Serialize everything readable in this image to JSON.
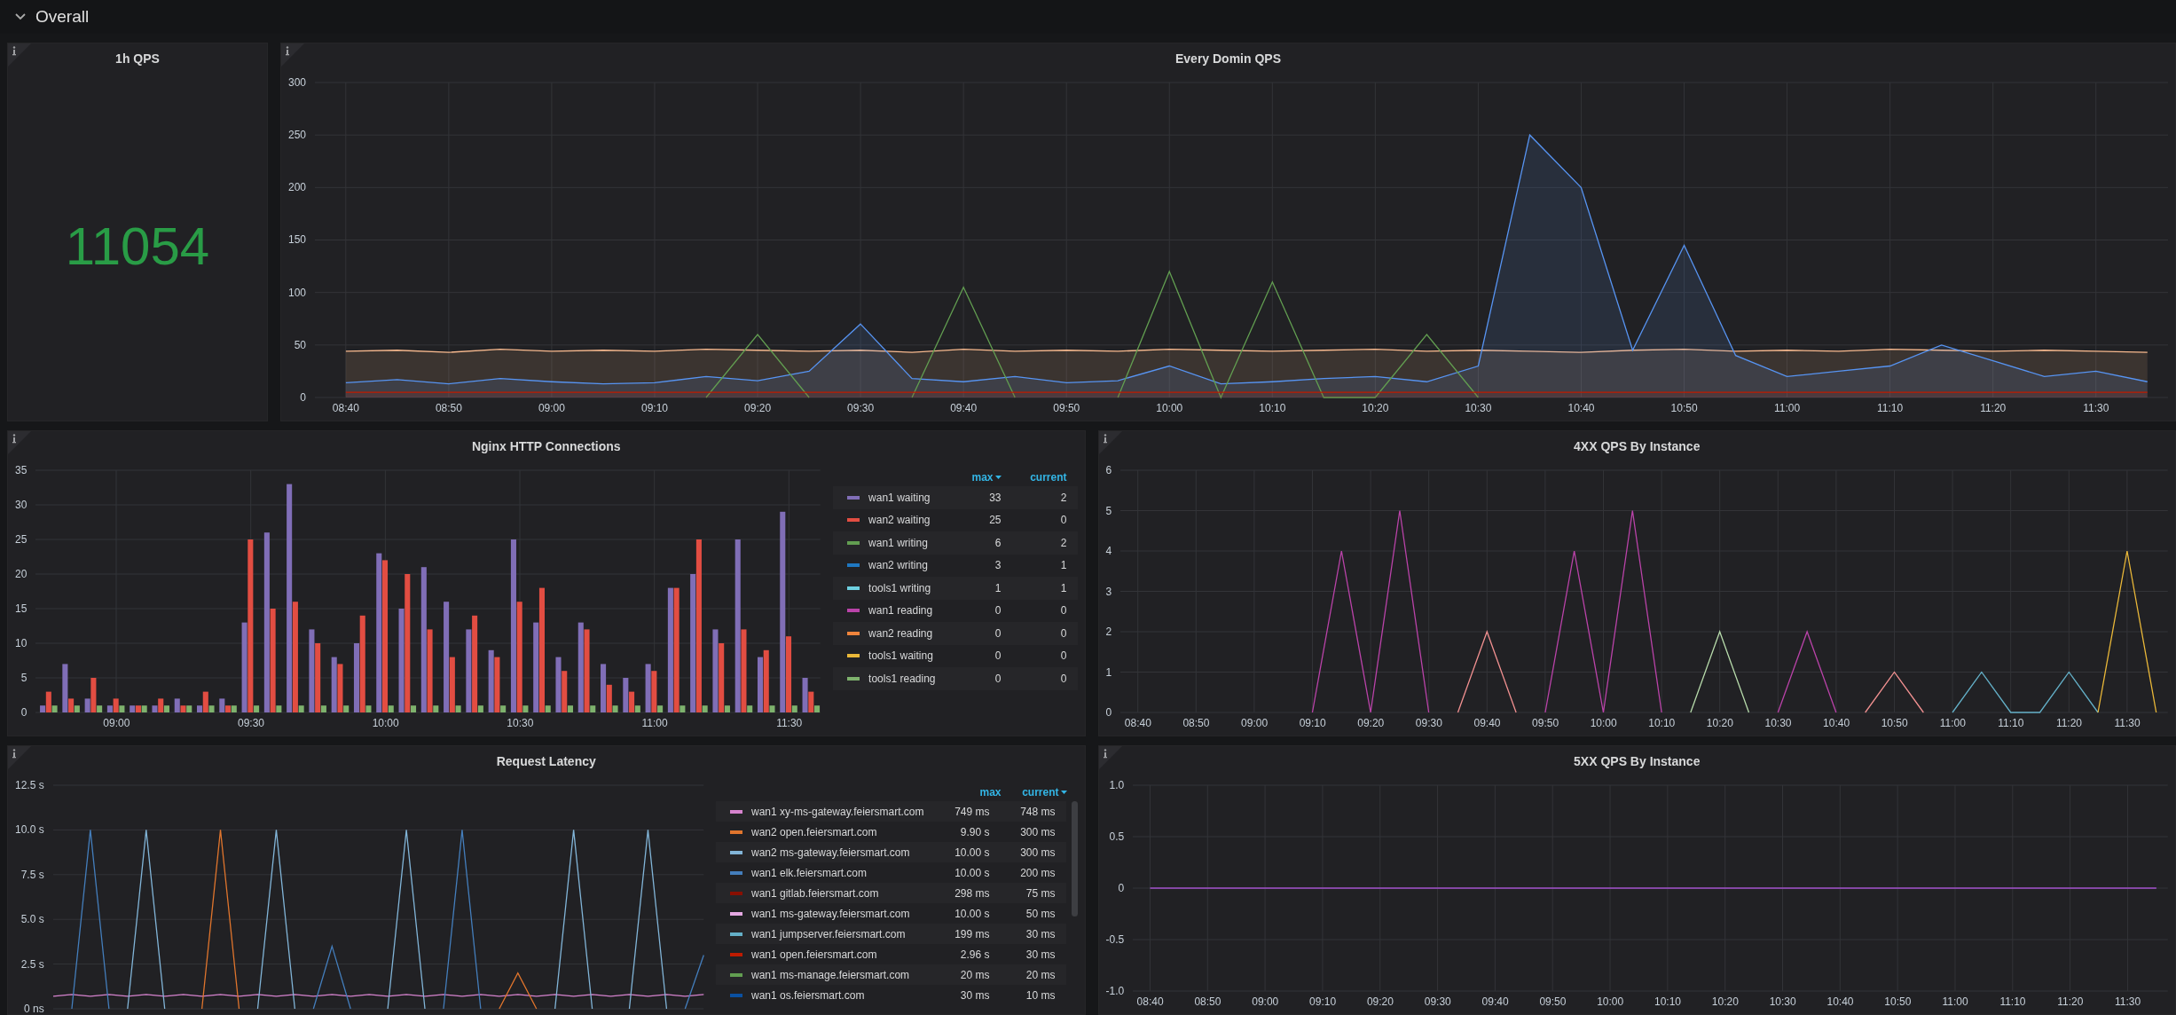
{
  "section": {
    "title": "Overall",
    "expanded": true
  },
  "rows": [
    {
      "panels": [
        {
          "kind": "stat",
          "title": "1h QPS",
          "value": "11054"
        },
        {
          "kind": "graph",
          "title": "Every Domin QPS",
          "chart_data": {
            "type": "area",
            "grid": true,
            "xlim": [
              517,
              697
            ],
            "ylim": [
              0,
              300
            ],
            "yticks": [
              0,
              50,
              100,
              150,
              200,
              250,
              300
            ],
            "x": [
              520,
              525,
              530,
              535,
              540,
              545,
              550,
              555,
              560,
              565,
              570,
              575,
              580,
              585,
              590,
              595,
              600,
              605,
              610,
              615,
              620,
              625,
              630,
              635,
              640,
              645,
              650,
              655,
              660,
              665,
              670,
              675,
              680,
              685,
              690,
              695
            ],
            "xticks": [
              {
                "value": 520,
                "label": "08:40"
              },
              {
                "value": 530,
                "label": "08:50"
              },
              {
                "value": 540,
                "label": "09:00"
              },
              {
                "value": 550,
                "label": "09:10"
              },
              {
                "value": 560,
                "label": "09:20"
              },
              {
                "value": 570,
                "label": "09:30"
              },
              {
                "value": 580,
                "label": "09:40"
              },
              {
                "value": 590,
                "label": "09:50"
              },
              {
                "value": 600,
                "label": "10:00"
              },
              {
                "value": 610,
                "label": "10:10"
              },
              {
                "value": 620,
                "label": "10:20"
              },
              {
                "value": 630,
                "label": "10:30"
              },
              {
                "value": 640,
                "label": "10:40"
              },
              {
                "value": 650,
                "label": "10:50"
              },
              {
                "value": 660,
                "label": "11:00"
              },
              {
                "value": 670,
                "label": "11:10"
              },
              {
                "value": 680,
                "label": "11:20"
              },
              {
                "value": 690,
                "label": "11:30"
              }
            ],
            "series": [
              {
                "color": "#f9ba8f",
                "values": [
                  44,
                  45,
                  43,
                  46,
                  44,
                  45,
                  44,
                  46,
                  45,
                  44,
                  45,
                  43,
                  46,
                  44,
                  45,
                  44,
                  46,
                  45,
                  44,
                  45,
                  46,
                  44,
                  45,
                  44,
                  43,
                  45,
                  46,
                  44,
                  45,
                  44,
                  46,
                  45,
                  44,
                  45,
                  44,
                  43
                ]
              },
              {
                "color": "#5794f2",
                "values": [
                  14,
                  17,
                  13,
                  18,
                  15,
                  13,
                  14,
                  20,
                  16,
                  25,
                  70,
                  18,
                  15,
                  20,
                  14,
                  16,
                  30,
                  13,
                  15,
                  18,
                  20,
                  15,
                  30,
                  250,
                  200,
                  45,
                  145,
                  40,
                  20,
                  25,
                  30,
                  50,
                  35,
                  20,
                  25,
                  15
                ]
              },
              {
                "color": "#629e51",
                "type": "line",
                "values": [
                  null,
                  null,
                  null,
                  null,
                  null,
                  null,
                  null,
                  0,
                  60,
                  0,
                  null,
                  0,
                  105,
                  0,
                  null,
                  0,
                  120,
                  0,
                  110,
                  0,
                  0,
                  60,
                  0,
                  null,
                  null,
                  null,
                  null,
                  null,
                  null,
                  null,
                  null,
                  null,
                  null,
                  null,
                  null,
                  null
                ]
              },
              {
                "color": "#bf1b00",
                "values": [
                  5,
                  5,
                  5,
                  5,
                  5,
                  5,
                  5,
                  5,
                  5,
                  5,
                  5,
                  5,
                  5,
                  5,
                  5,
                  5,
                  5,
                  5,
                  5,
                  5,
                  5,
                  5,
                  5,
                  5,
                  5,
                  5,
                  5,
                  5,
                  5,
                  5,
                  5,
                  5,
                  5,
                  5,
                  5,
                  5
                ]
              }
            ]
          }
        }
      ]
    },
    {
      "panels": [
        {
          "kind": "graph",
          "title": "Nginx HTTP Connections",
          "chart_data": {
            "type": "bar",
            "grid": true,
            "xlim": [
              522,
              697
            ],
            "ylim": [
              0,
              35
            ],
            "yticks": [
              0,
              5,
              10,
              15,
              20,
              25,
              30,
              35
            ],
            "x": [
              525,
              530,
              535,
              540,
              545,
              550,
              555,
              560,
              565,
              570,
              575,
              580,
              585,
              590,
              595,
              600,
              605,
              610,
              615,
              620,
              625,
              630,
              635,
              640,
              645,
              650,
              655,
              660,
              665,
              670,
              675,
              680,
              685,
              690,
              695
            ],
            "xticks": [
              {
                "value": 540,
                "label": "09:00"
              },
              {
                "value": 570,
                "label": "09:30"
              },
              {
                "value": 600,
                "label": "10:00"
              },
              {
                "value": 630,
                "label": "10:30"
              },
              {
                "value": 660,
                "label": "11:00"
              },
              {
                "value": 690,
                "label": "11:30"
              }
            ],
            "series": [
              {
                "color": "#806eb7",
                "values": [
                  1,
                  7,
                  2,
                  1,
                  1,
                  1,
                  2,
                  1,
                  2,
                  13,
                  26,
                  33,
                  12,
                  8,
                  10,
                  23,
                  15,
                  21,
                  16,
                  12,
                  9,
                  25,
                  13,
                  8,
                  13,
                  7,
                  5,
                  7,
                  18,
                  20,
                  12,
                  25,
                  8,
                  29,
                  5
                ]
              },
              {
                "color": "#e24d42",
                "values": [
                  3,
                  2,
                  5,
                  2,
                  1,
                  2,
                  1,
                  3,
                  1,
                  25,
                  15,
                  16,
                  10,
                  7,
                  14,
                  22,
                  20,
                  12,
                  8,
                  14,
                  8,
                  16,
                  18,
                  6,
                  12,
                  4,
                  3,
                  6,
                  18,
                  25,
                  10,
                  12,
                  9,
                  11,
                  3
                ]
              },
              {
                "color": "#7eb26d",
                "values": [
                  1,
                  1,
                  1,
                  1,
                  1,
                  1,
                  1,
                  1,
                  1,
                  1,
                  1,
                  1,
                  1,
                  1,
                  1,
                  1,
                  1,
                  1,
                  1,
                  1,
                  1,
                  1,
                  1,
                  1,
                  1,
                  1,
                  1,
                  1,
                  1,
                  1,
                  1,
                  1,
                  1,
                  1,
                  1
                ]
              }
            ]
          },
          "legend": {
            "columns": [
              {
                "label": "max",
                "sorted": true
              },
              {
                "label": "current",
                "sorted": false
              }
            ],
            "rows": [
              {
                "name": "wan1 waiting",
                "color": "#806eb7",
                "max": "33",
                "current": "2"
              },
              {
                "name": "wan2 waiting",
                "color": "#e24d42",
                "max": "25",
                "current": "0"
              },
              {
                "name": "wan1 writing",
                "color": "#629e51",
                "max": "6",
                "current": "2"
              },
              {
                "name": "wan2 writing",
                "color": "#1f78c1",
                "max": "3",
                "current": "1"
              },
              {
                "name": "tools1 writing",
                "color": "#6ed0e0",
                "max": "1",
                "current": "1"
              },
              {
                "name": "wan1 reading",
                "color": "#ba43a9",
                "max": "0",
                "current": "0"
              },
              {
                "name": "wan2 reading",
                "color": "#ef843c",
                "max": "0",
                "current": "0"
              },
              {
                "name": "tools1 waiting",
                "color": "#eab839",
                "max": "0",
                "current": "0"
              },
              {
                "name": "tools1 reading",
                "color": "#7eb26d",
                "max": "0",
                "current": "0"
              }
            ]
          }
        },
        {
          "kind": "graph",
          "title": "4XX QPS By Instance",
          "chart_data": {
            "type": "line",
            "grid": true,
            "xlim": [
              517,
              697
            ],
            "ylim": [
              0,
              6
            ],
            "yticks": [
              0,
              1,
              2,
              3,
              4,
              5,
              6
            ],
            "x": [
              550,
              555,
              560,
              565,
              570,
              575,
              580,
              585,
              590,
              595,
              600,
              605,
              610,
              615,
              620,
              625,
              630,
              635,
              640,
              645,
              650,
              655,
              660,
              665,
              670,
              675,
              680,
              685,
              690,
              695
            ],
            "xticks": [
              {
                "value": 520,
                "label": "08:40"
              },
              {
                "value": 530,
                "label": "08:50"
              },
              {
                "value": 540,
                "label": "09:00"
              },
              {
                "value": 550,
                "label": "09:10"
              },
              {
                "value": 560,
                "label": "09:20"
              },
              {
                "value": 570,
                "label": "09:30"
              },
              {
                "value": 580,
                "label": "09:40"
              },
              {
                "value": 590,
                "label": "09:50"
              },
              {
                "value": 600,
                "label": "10:00"
              },
              {
                "value": 610,
                "label": "10:10"
              },
              {
                "value": 620,
                "label": "10:20"
              },
              {
                "value": 630,
                "label": "10:30"
              },
              {
                "value": 640,
                "label": "10:40"
              },
              {
                "value": 650,
                "label": "10:50"
              },
              {
                "value": 660,
                "label": "11:00"
              },
              {
                "value": 670,
                "label": "11:10"
              },
              {
                "value": 680,
                "label": "11:20"
              },
              {
                "value": 690,
                "label": "11:30"
              }
            ],
            "series": [
              {
                "color": "#ba43a9",
                "values": [
                  0,
                  4,
                  0,
                  5,
                  0,
                  null,
                  null,
                  null,
                  0,
                  4,
                  0,
                  5,
                  0,
                  null,
                  null,
                  null,
                  0,
                  2,
                  0,
                  null,
                  null,
                  null,
                  null,
                  null,
                  null,
                  null,
                  null,
                  null,
                  null,
                  null
                ]
              },
              {
                "color": "#f29191",
                "values": [
                  null,
                  null,
                  null,
                  null,
                  null,
                  0,
                  2,
                  0,
                  null,
                  null,
                  null,
                  null,
                  null,
                  null,
                  null,
                  null,
                  null,
                  null,
                  null,
                  0,
                  1,
                  0,
                  null,
                  null,
                  null,
                  null,
                  null,
                  null,
                  null,
                  null
                ]
              },
              {
                "color": "#b7dbab",
                "values": [
                  null,
                  null,
                  null,
                  null,
                  null,
                  null,
                  null,
                  null,
                  null,
                  null,
                  null,
                  null,
                  null,
                  0,
                  2,
                  0,
                  null,
                  null,
                  null,
                  null,
                  null,
                  null,
                  null,
                  null,
                  null,
                  null,
                  null,
                  null,
                  null,
                  null
                ]
              },
              {
                "color": "#64b0c8",
                "values": [
                  null,
                  null,
                  null,
                  null,
                  null,
                  null,
                  null,
                  null,
                  null,
                  null,
                  null,
                  null,
                  null,
                  null,
                  null,
                  null,
                  null,
                  null,
                  null,
                  null,
                  null,
                  null,
                  0,
                  1,
                  0,
                  0,
                  1,
                  0,
                  null,
                  null
                ]
              },
              {
                "color": "#eab839",
                "values": [
                  null,
                  null,
                  null,
                  null,
                  null,
                  null,
                  null,
                  null,
                  null,
                  null,
                  null,
                  null,
                  null,
                  null,
                  null,
                  null,
                  null,
                  null,
                  null,
                  null,
                  null,
                  null,
                  null,
                  null,
                  null,
                  null,
                  null,
                  0,
                  4,
                  0
                ]
              }
            ]
          }
        }
      ]
    },
    {
      "panels": [
        {
          "kind": "graph",
          "title": "Request Latency",
          "chart_data": {
            "type": "line",
            "grid": true,
            "ylim": [
              0,
              12.5
            ],
            "categories": [
              null,
              null,
              null,
              null,
              null,
              null,
              null,
              null,
              null,
              null,
              null,
              null,
              null,
              null,
              null,
              null,
              null,
              null,
              null,
              null,
              null,
              null,
              null,
              null,
              null,
              null,
              null,
              null,
              null,
              null,
              null,
              null,
              null,
              null,
              null,
              null
            ],
            "yticks": [
              {
                "value": 0,
                "label": "0 ns"
              },
              {
                "value": 2.5,
                "label": "2.5 s"
              },
              {
                "value": 5,
                "label": "5.0 s"
              },
              {
                "value": 7.5,
                "label": "7.5 s"
              },
              {
                "value": 10,
                "label": "10.0 s"
              },
              {
                "value": 12.5,
                "label": "12.5 s"
              }
            ],
            "series": [
              {
                "color": "#d683ce",
                "values": [
                  0.7,
                  0.8,
                  0.7,
                  0.8,
                  0.7,
                  0.8,
                  0.7,
                  0.8,
                  0.7,
                  0.8,
                  0.7,
                  0.8,
                  0.7,
                  0.8,
                  0.7,
                  0.8,
                  0.7,
                  0.8,
                  0.7,
                  0.8,
                  0.7,
                  0.8,
                  0.7,
                  0.8,
                  0.7,
                  0.8,
                  0.7,
                  0.8,
                  0.7,
                  0.8,
                  0.7,
                  0.8,
                  0.7,
                  0.8,
                  0.7,
                  0.8
                ]
              },
              {
                "color": "#e0752d",
                "values": [
                  null,
                  null,
                  null,
                  null,
                  null,
                  null,
                  null,
                  null,
                  0,
                  10,
                  0,
                  null,
                  null,
                  null,
                  null,
                  null,
                  null,
                  null,
                  null,
                  null,
                  null,
                  null,
                  null,
                  null,
                  0,
                  2,
                  0,
                  null,
                  null,
                  null,
                  null,
                  null,
                  null,
                  null,
                  null,
                  null
                ]
              },
              {
                "color": "#82b5d8",
                "values": [
                  null,
                  null,
                  null,
                  null,
                  0,
                  10,
                  0,
                  null,
                  null,
                  null,
                  null,
                  0,
                  10,
                  0,
                  null,
                  null,
                  null,
                  null,
                  0,
                  10,
                  0,
                  null,
                  null,
                  null,
                  null,
                  null,
                  null,
                  0,
                  10,
                  0,
                  null,
                  0,
                  10,
                  0,
                  null,
                  null
                ]
              },
              {
                "color": "#447ebc",
                "values": [
                  null,
                  0,
                  10,
                  0,
                  null,
                  null,
                  null,
                  null,
                  null,
                  null,
                  null,
                  null,
                  null,
                  null,
                  0,
                  3.5,
                  0,
                  null,
                  null,
                  null,
                  null,
                  0,
                  10,
                  0,
                  null,
                  null,
                  null,
                  null,
                  null,
                  null,
                  null,
                  null,
                  null,
                  null,
                  0,
                  3
                ]
              }
            ]
          },
          "legend": {
            "scrollable": true,
            "columns": [
              {
                "label": "max",
                "sorted": false
              },
              {
                "label": "current",
                "sorted": true
              }
            ],
            "rows": [
              {
                "name": "wan1 xy-ms-gateway.feiersmart.com",
                "color": "#d683ce",
                "max": "749 ms",
                "current": "748 ms"
              },
              {
                "name": "wan2 open.feiersmart.com",
                "color": "#e0752d",
                "max": "9.90 s",
                "current": "300 ms"
              },
              {
                "name": "wan2 ms-gateway.feiersmart.com",
                "color": "#82b5d8",
                "max": "10.00 s",
                "current": "300 ms"
              },
              {
                "name": "wan1 elk.feiersmart.com",
                "color": "#447ebc",
                "max": "10.00 s",
                "current": "200 ms"
              },
              {
                "name": "wan1 gitlab.feiersmart.com",
                "color": "#890f02",
                "max": "298 ms",
                "current": "75 ms"
              },
              {
                "name": "wan1 ms-gateway.feiersmart.com",
                "color": "#e5a8e2",
                "max": "10.00 s",
                "current": "50 ms"
              },
              {
                "name": "wan1 jumpserver.feiersmart.com",
                "color": "#64b0c8",
                "max": "199 ms",
                "current": "30 ms"
              },
              {
                "name": "wan1 open.feiersmart.com",
                "color": "#bf1b00",
                "max": "2.96 s",
                "current": "30 ms"
              },
              {
                "name": "wan1 ms-manage.feiersmart.com",
                "color": "#629e51",
                "max": "20 ms",
                "current": "20 ms"
              },
              {
                "name": "wan1 os.feiersmart.com",
                "color": "#0a50a1",
                "max": "30 ms",
                "current": "10 ms"
              }
            ]
          }
        },
        {
          "kind": "graph",
          "title": "5XX QPS By Instance",
          "chart_data": {
            "type": "line",
            "grid": true,
            "xlim": [
              517,
              697
            ],
            "ylim": [
              -1,
              1
            ],
            "x": [
              520,
              525,
              530,
              535,
              540,
              545,
              550,
              555,
              560,
              565,
              570,
              575,
              580,
              585,
              590,
              595,
              600,
              605,
              610,
              615,
              620,
              625,
              630,
              635,
              640,
              645,
              650,
              655,
              660,
              665,
              670,
              675,
              680,
              685,
              690,
              695
            ],
            "yticks": [
              {
                "value": -1,
                "label": "-1.0"
              },
              {
                "value": -0.5,
                "label": "-0.5"
              },
              {
                "value": 0,
                "label": "0"
              },
              {
                "value": 0.5,
                "label": "0.5"
              },
              {
                "value": 1,
                "label": "1.0"
              }
            ],
            "xticks": [
              {
                "value": 520,
                "label": "08:40"
              },
              {
                "value": 530,
                "label": "08:50"
              },
              {
                "value": 540,
                "label": "09:00"
              },
              {
                "value": 550,
                "label": "09:10"
              },
              {
                "value": 560,
                "label": "09:20"
              },
              {
                "value": 570,
                "label": "09:30"
              },
              {
                "value": 580,
                "label": "09:40"
              },
              {
                "value": 590,
                "label": "09:50"
              },
              {
                "value": 600,
                "label": "10:00"
              },
              {
                "value": 610,
                "label": "10:10"
              },
              {
                "value": 620,
                "label": "10:20"
              },
              {
                "value": 630,
                "label": "10:30"
              },
              {
                "value": 640,
                "label": "10:40"
              },
              {
                "value": 650,
                "label": "10:50"
              },
              {
                "value": 660,
                "label": "11:00"
              },
              {
                "value": 670,
                "label": "11:10"
              },
              {
                "value": 680,
                "label": "11:20"
              },
              {
                "value": 690,
                "label": "11:30"
              }
            ],
            "series": [
              {
                "color": "#a352cc",
                "values": [
                  0,
                  0,
                  0,
                  0,
                  0,
                  0,
                  0,
                  0,
                  0,
                  0,
                  0,
                  0,
                  0,
                  0,
                  0,
                  0,
                  0,
                  0,
                  0,
                  0,
                  0,
                  0,
                  0,
                  0,
                  0,
                  0,
                  0,
                  0,
                  0,
                  0,
                  0,
                  0,
                  0,
                  0,
                  0,
                  0
                ]
              }
            ]
          }
        }
      ]
    }
  ]
}
